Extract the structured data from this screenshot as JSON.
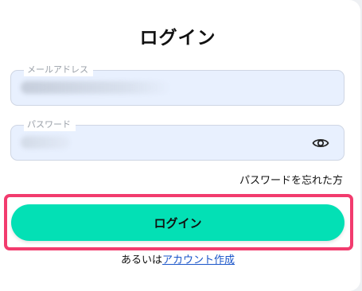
{
  "login": {
    "title": "ログイン",
    "email": {
      "label": "メールアドレス"
    },
    "password": {
      "label": "パスワード"
    },
    "forgot_password": "パスワードを忘れた方",
    "submit_label": "ログイン",
    "signup_prefix": "あるいは",
    "signup_link": "アカウント作成"
  },
  "colors": {
    "primary_button": "#03e0b5",
    "highlight_border": "#f23b6e",
    "link": "#1a55c9",
    "input_background": "#e8f0fe"
  },
  "icons": {
    "password_toggle": "eye-icon"
  }
}
